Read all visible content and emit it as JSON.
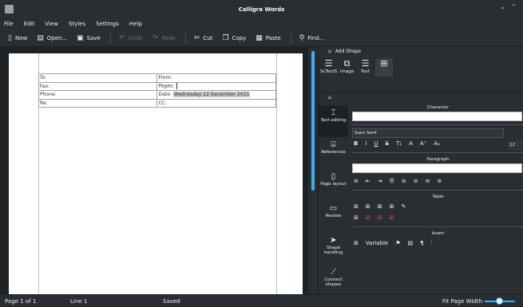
{
  "window": {
    "title": "Calligra Words"
  },
  "menu": [
    "File",
    "Edit",
    "View",
    "Styles",
    "Settings",
    "Help"
  ],
  "toolbar": {
    "new": "New",
    "open": "Open...",
    "save": "Save",
    "undo": "Undo",
    "redo": "Redo",
    "cut": "Cut",
    "copy": "Copy",
    "paste": "Paste",
    "find": "Find..."
  },
  "fax": {
    "to": "To:",
    "from": "From:",
    "fax": "Fax:",
    "pages": "Pages:",
    "phone": "Phone:",
    "date": "Date:",
    "date_value": "Wednesday 22 December 2021",
    "re": "Re:",
    "cc": "CC:"
  },
  "add_shape": {
    "title": "Add Shape",
    "items": [
      "ScTextS",
      "Image",
      "Text"
    ]
  },
  "tools": [
    "Text editing",
    "References",
    "Page layout",
    "Review",
    "Shape handling",
    "Connect shapes"
  ],
  "options": {
    "character": "Character",
    "font": "Sans Serif",
    "size": "12",
    "paragraph": "Paragraph",
    "table": "Table",
    "insert": "Insert",
    "variable": "Variable"
  },
  "status": {
    "page": "Page 1 of 1",
    "line": "Line 1",
    "saved": "Saved",
    "zoom": "Fit Page Width"
  },
  "colors": {
    "accent": "#3daee9",
    "bg": "#2a2e32"
  }
}
